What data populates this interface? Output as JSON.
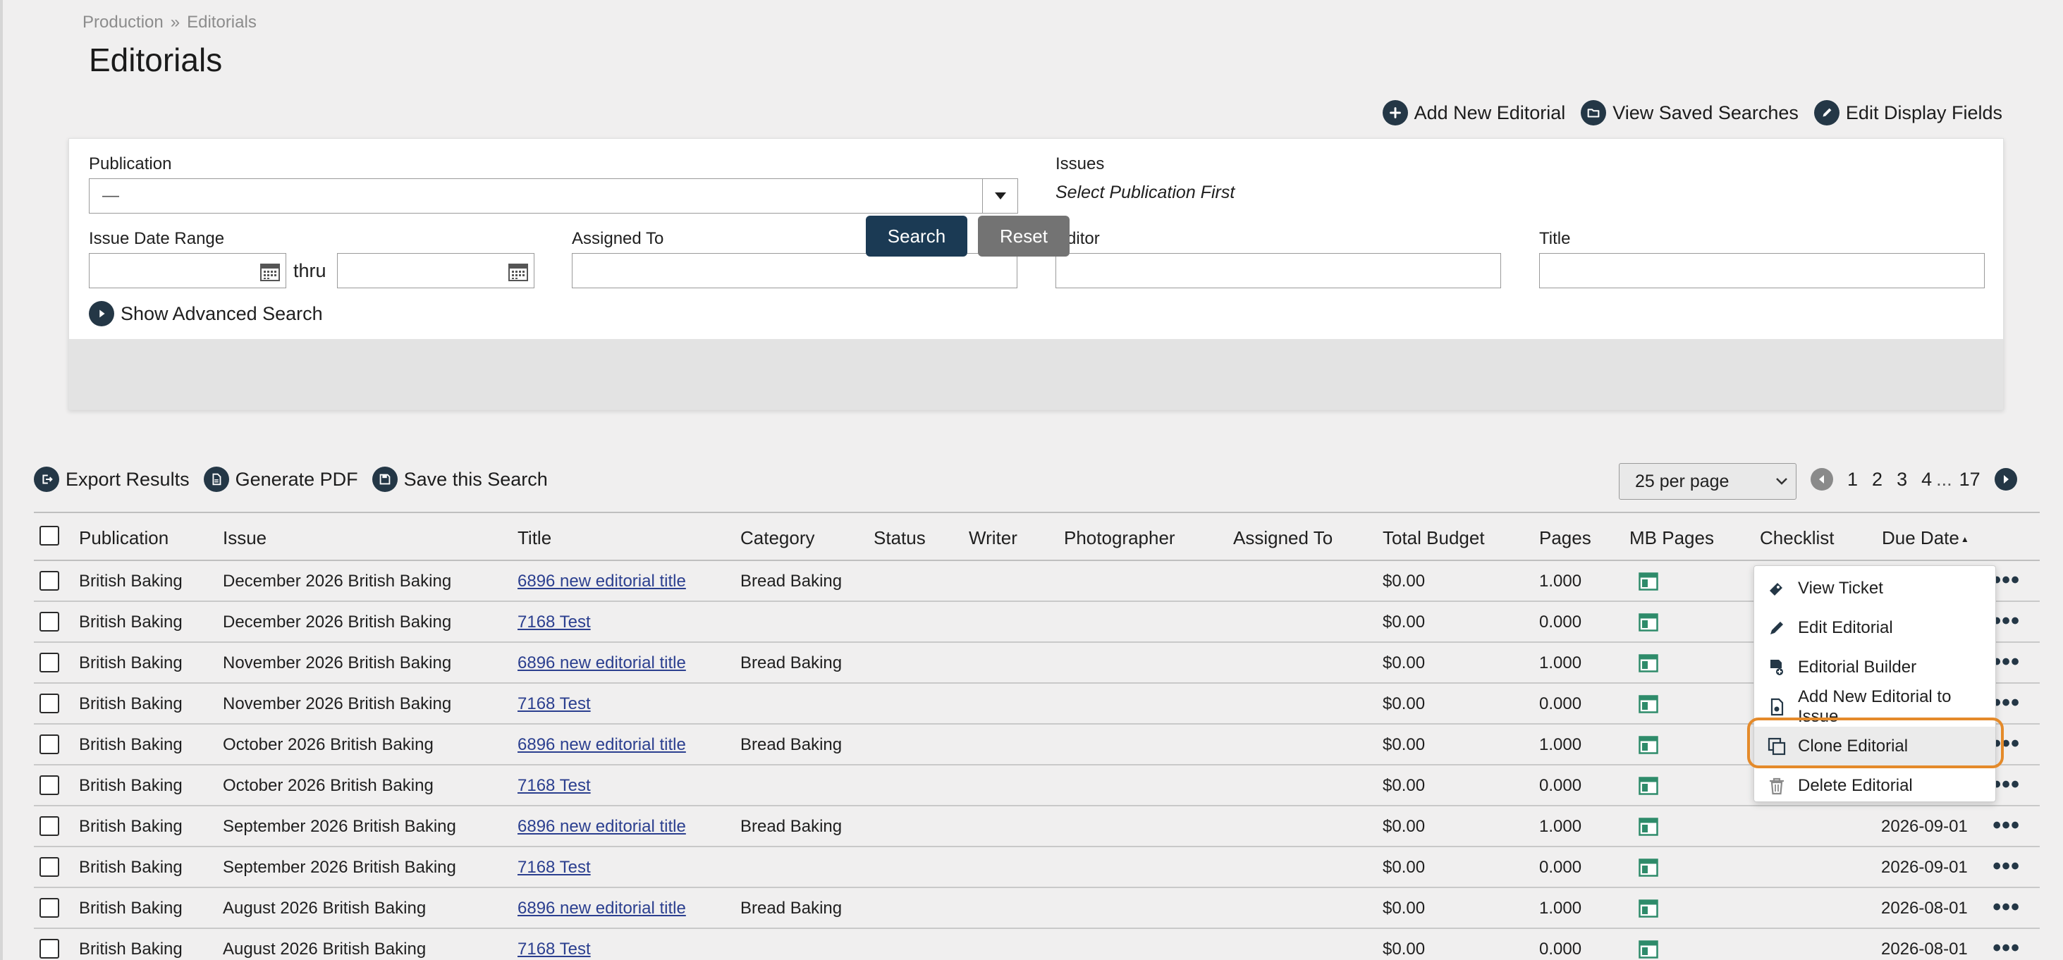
{
  "breadcrumb": {
    "root": "Production",
    "sep": "»",
    "current": "Editorials"
  },
  "page_title": "Editorials",
  "top_actions": {
    "add_new": "Add New Editorial",
    "saved_searches": "View Saved Searches",
    "edit_fields": "Edit Display Fields"
  },
  "search": {
    "publication_label": "Publication",
    "publication_value": "—",
    "issues_label": "Issues",
    "issues_hint": "Select Publication First",
    "date_range_label": "Issue Date Range",
    "thru": "thru",
    "assigned_label": "Assigned To",
    "editor_label": "Editor",
    "title_label": "Title",
    "advanced": "Show Advanced Search",
    "search_btn": "Search",
    "reset_btn": "Reset"
  },
  "results_toolbar": {
    "export": "Export Results",
    "pdf": "Generate PDF",
    "save": "Save this Search",
    "per_page": "25 per page",
    "pages": [
      "1",
      "2",
      "3",
      "4"
    ],
    "ellipsis": "...",
    "last_page": "17"
  },
  "table": {
    "headers": {
      "publication": "Publication",
      "issue": "Issue",
      "title": "Title",
      "category": "Category",
      "status": "Status",
      "writer": "Writer",
      "photographer": "Photographer",
      "assigned": "Assigned To",
      "budget": "Total Budget",
      "pages": "Pages",
      "mb_pages": "MB Pages",
      "checklist": "Checklist",
      "due_date": "Due Date"
    },
    "sort_indicator": "▲",
    "rows": [
      {
        "publication": "British Baking",
        "issue": "December 2026 British Baking",
        "title": "6896 new editorial title",
        "category": "Bread Baking",
        "budget": "$0.00",
        "pages": "1.000",
        "due": ""
      },
      {
        "publication": "British Baking",
        "issue": "December 2026 British Baking",
        "title": "7168 Test",
        "category": "",
        "budget": "$0.00",
        "pages": "0.000",
        "due": ""
      },
      {
        "publication": "British Baking",
        "issue": "November 2026 British Baking",
        "title": "6896 new editorial title",
        "category": "Bread Baking",
        "budget": "$0.00",
        "pages": "1.000",
        "due": ""
      },
      {
        "publication": "British Baking",
        "issue": "November 2026 British Baking",
        "title": "7168 Test",
        "category": "",
        "budget": "$0.00",
        "pages": "0.000",
        "due": ""
      },
      {
        "publication": "British Baking",
        "issue": "October 2026 British Baking",
        "title": "6896 new editorial title",
        "category": "Bread Baking",
        "budget": "$0.00",
        "pages": "1.000",
        "due": ""
      },
      {
        "publication": "British Baking",
        "issue": "October 2026 British Baking",
        "title": "7168 Test",
        "category": "",
        "budget": "$0.00",
        "pages": "0.000",
        "due": ""
      },
      {
        "publication": "British Baking",
        "issue": "September 2026 British Baking",
        "title": "6896 new editorial title",
        "category": "Bread Baking",
        "budget": "$0.00",
        "pages": "1.000",
        "due": "2026-09-01"
      },
      {
        "publication": "British Baking",
        "issue": "September 2026 British Baking",
        "title": "7168 Test",
        "category": "",
        "budget": "$0.00",
        "pages": "0.000",
        "due": "2026-09-01"
      },
      {
        "publication": "British Baking",
        "issue": "August 2026 British Baking",
        "title": "6896 new editorial title",
        "category": "Bread Baking",
        "budget": "$0.00",
        "pages": "1.000",
        "due": "2026-08-01"
      },
      {
        "publication": "British Baking",
        "issue": "August 2026 British Baking",
        "title": "7168 Test",
        "category": "",
        "budget": "$0.00",
        "pages": "0.000",
        "due": "2026-08-01"
      }
    ],
    "more_glyph": "•••"
  },
  "context_menu": {
    "items": [
      "View Ticket",
      "Edit Editorial",
      "Editorial Builder",
      "Add New Editorial to Issue",
      "Clone Editorial",
      "Delete Editorial"
    ],
    "highlighted": "Clone Editorial"
  },
  "colors": {
    "primary": "#1b3a54",
    "icon_dark": "#243746",
    "reset": "#737373",
    "link": "#2b3f8f",
    "mb_icon": "#2e8b6a",
    "highlight_ring": "#e48a2a",
    "background": "#f0efef"
  },
  "icons": {
    "add": "plus-circle-icon",
    "saved": "folder-icon",
    "edit": "pencil-icon",
    "calendar": "calendar-icon",
    "advanced": "play-circle-icon",
    "export": "export-icon",
    "pdf": "pdf-icon",
    "save": "save-icon",
    "more": "ellipsis-icon",
    "mb_pages": "page-layout-icon"
  }
}
